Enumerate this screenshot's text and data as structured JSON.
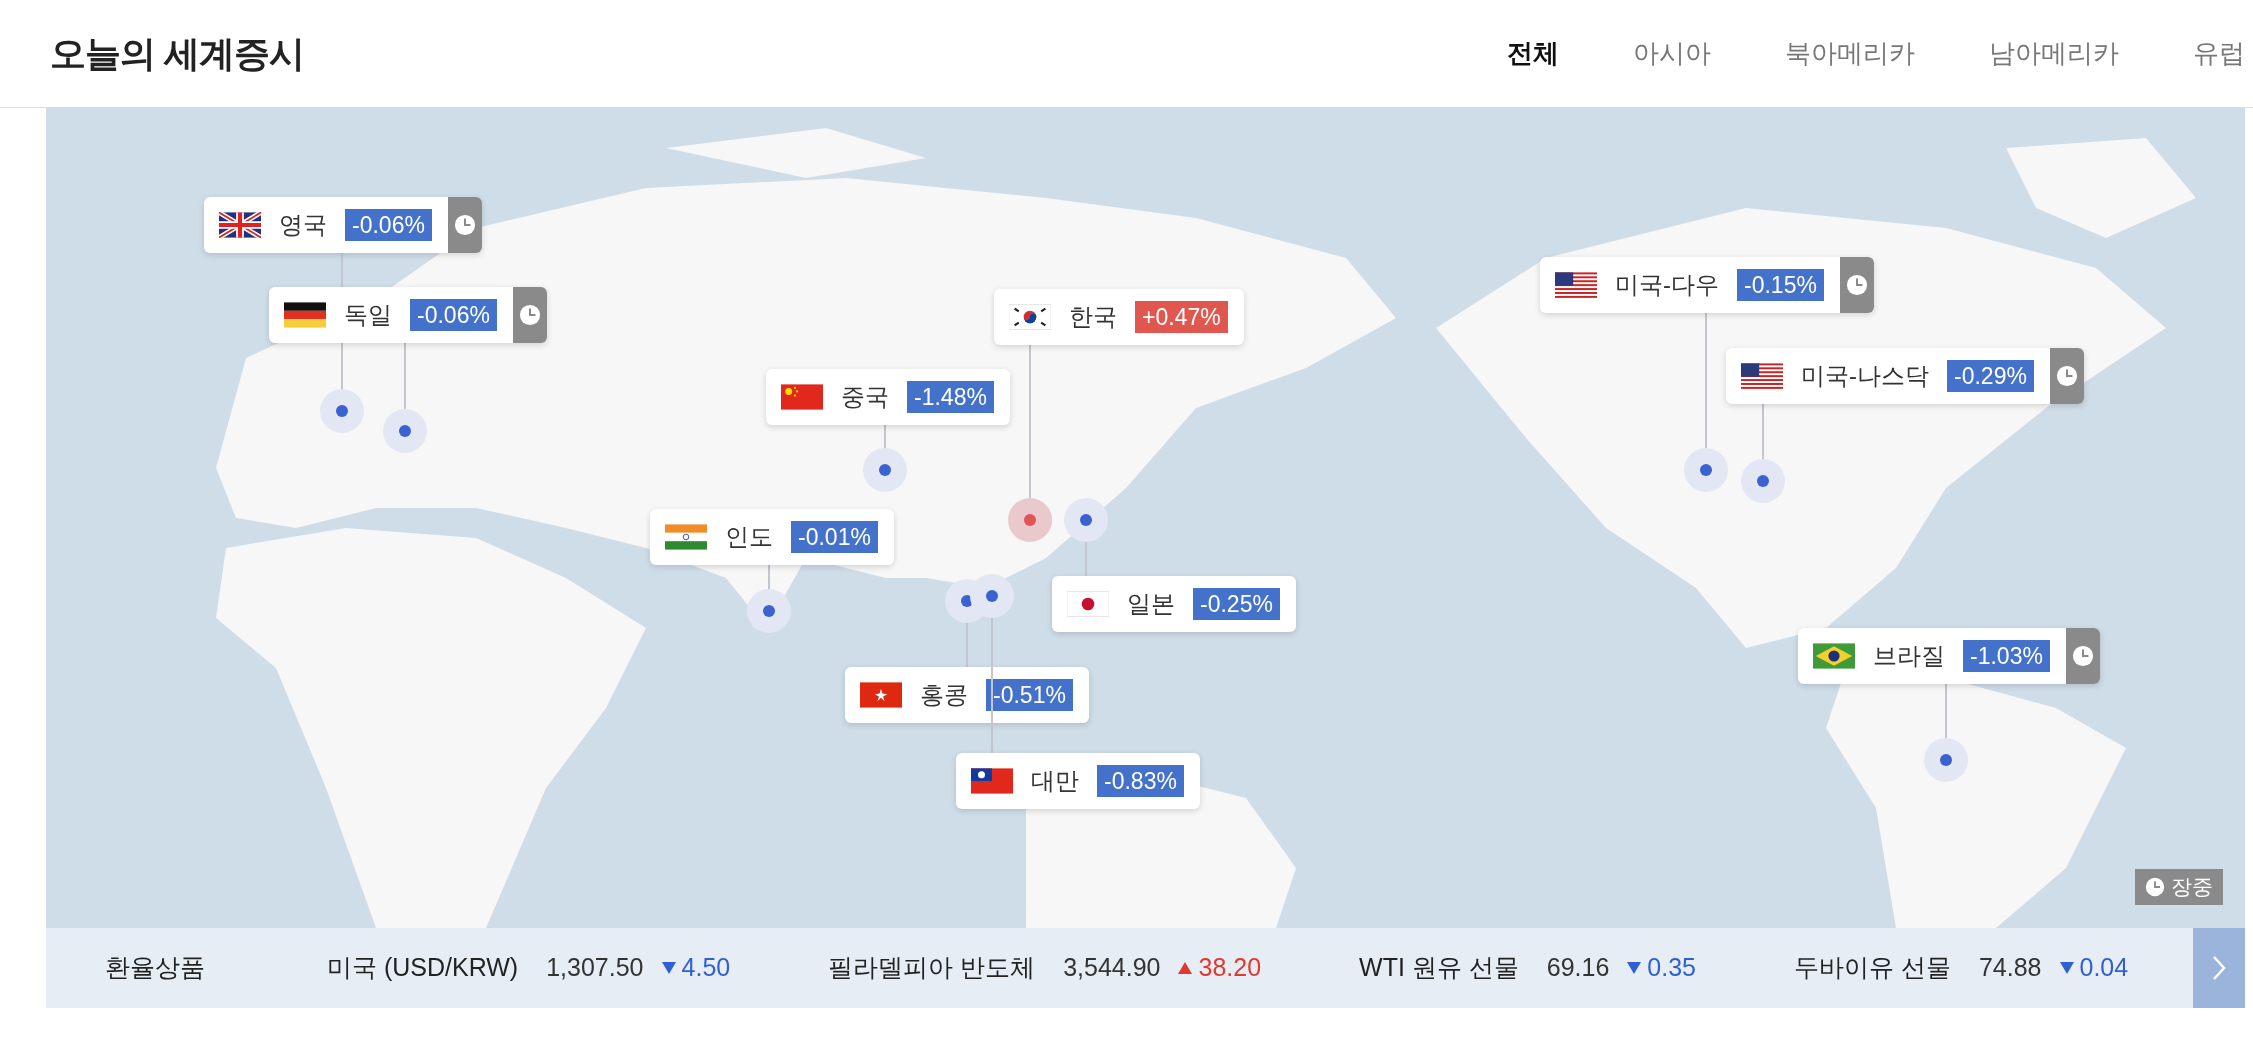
{
  "title": "오늘의 세계증시",
  "tabs": [
    {
      "label": "전체",
      "selected": true
    },
    {
      "label": "아시아",
      "selected": false
    },
    {
      "label": "북아메리카",
      "selected": false
    },
    {
      "label": "남아메리카",
      "selected": false
    },
    {
      "label": "유럽",
      "selected": false
    }
  ],
  "markets": [
    {
      "name": "영국",
      "change": "-0.06%",
      "rising": false,
      "clock": true
    },
    {
      "name": "독일",
      "change": "-0.06%",
      "rising": false,
      "clock": true
    },
    {
      "name": "한국",
      "change": "+0.47%",
      "rising": true,
      "clock": false
    },
    {
      "name": "중국",
      "change": "-1.48%",
      "rising": false,
      "clock": false
    },
    {
      "name": "인도",
      "change": "-0.01%",
      "rising": false,
      "clock": false
    },
    {
      "name": "일본",
      "change": "-0.25%",
      "rising": false,
      "clock": false
    },
    {
      "name": "홍콩",
      "change": "-0.51%",
      "rising": false,
      "clock": false
    },
    {
      "name": "대만",
      "change": "-0.83%",
      "rising": false,
      "clock": false
    },
    {
      "name": "미국-다우",
      "change": "-0.15%",
      "rising": false,
      "clock": true
    },
    {
      "name": "미국-나스닥",
      "change": "-0.29%",
      "rising": false,
      "clock": true
    },
    {
      "name": "브라질",
      "change": "-1.03%",
      "rising": false,
      "clock": true
    }
  ],
  "session_badge": "장중",
  "ticker": {
    "label": "환율상품",
    "items": [
      {
        "name": "미국 (USD/KRW)",
        "price": "1,307.50",
        "change": "4.50",
        "rising": false
      },
      {
        "name": "필라델피아 반도체",
        "price": "3,544.90",
        "change": "38.20",
        "rising": true
      },
      {
        "name": "WTI 원유 선물",
        "price": "69.16",
        "change": "0.35",
        "rising": false
      },
      {
        "name": "두바이유 선물",
        "price": "74.88",
        "change": "0.04",
        "rising": false
      }
    ]
  }
}
